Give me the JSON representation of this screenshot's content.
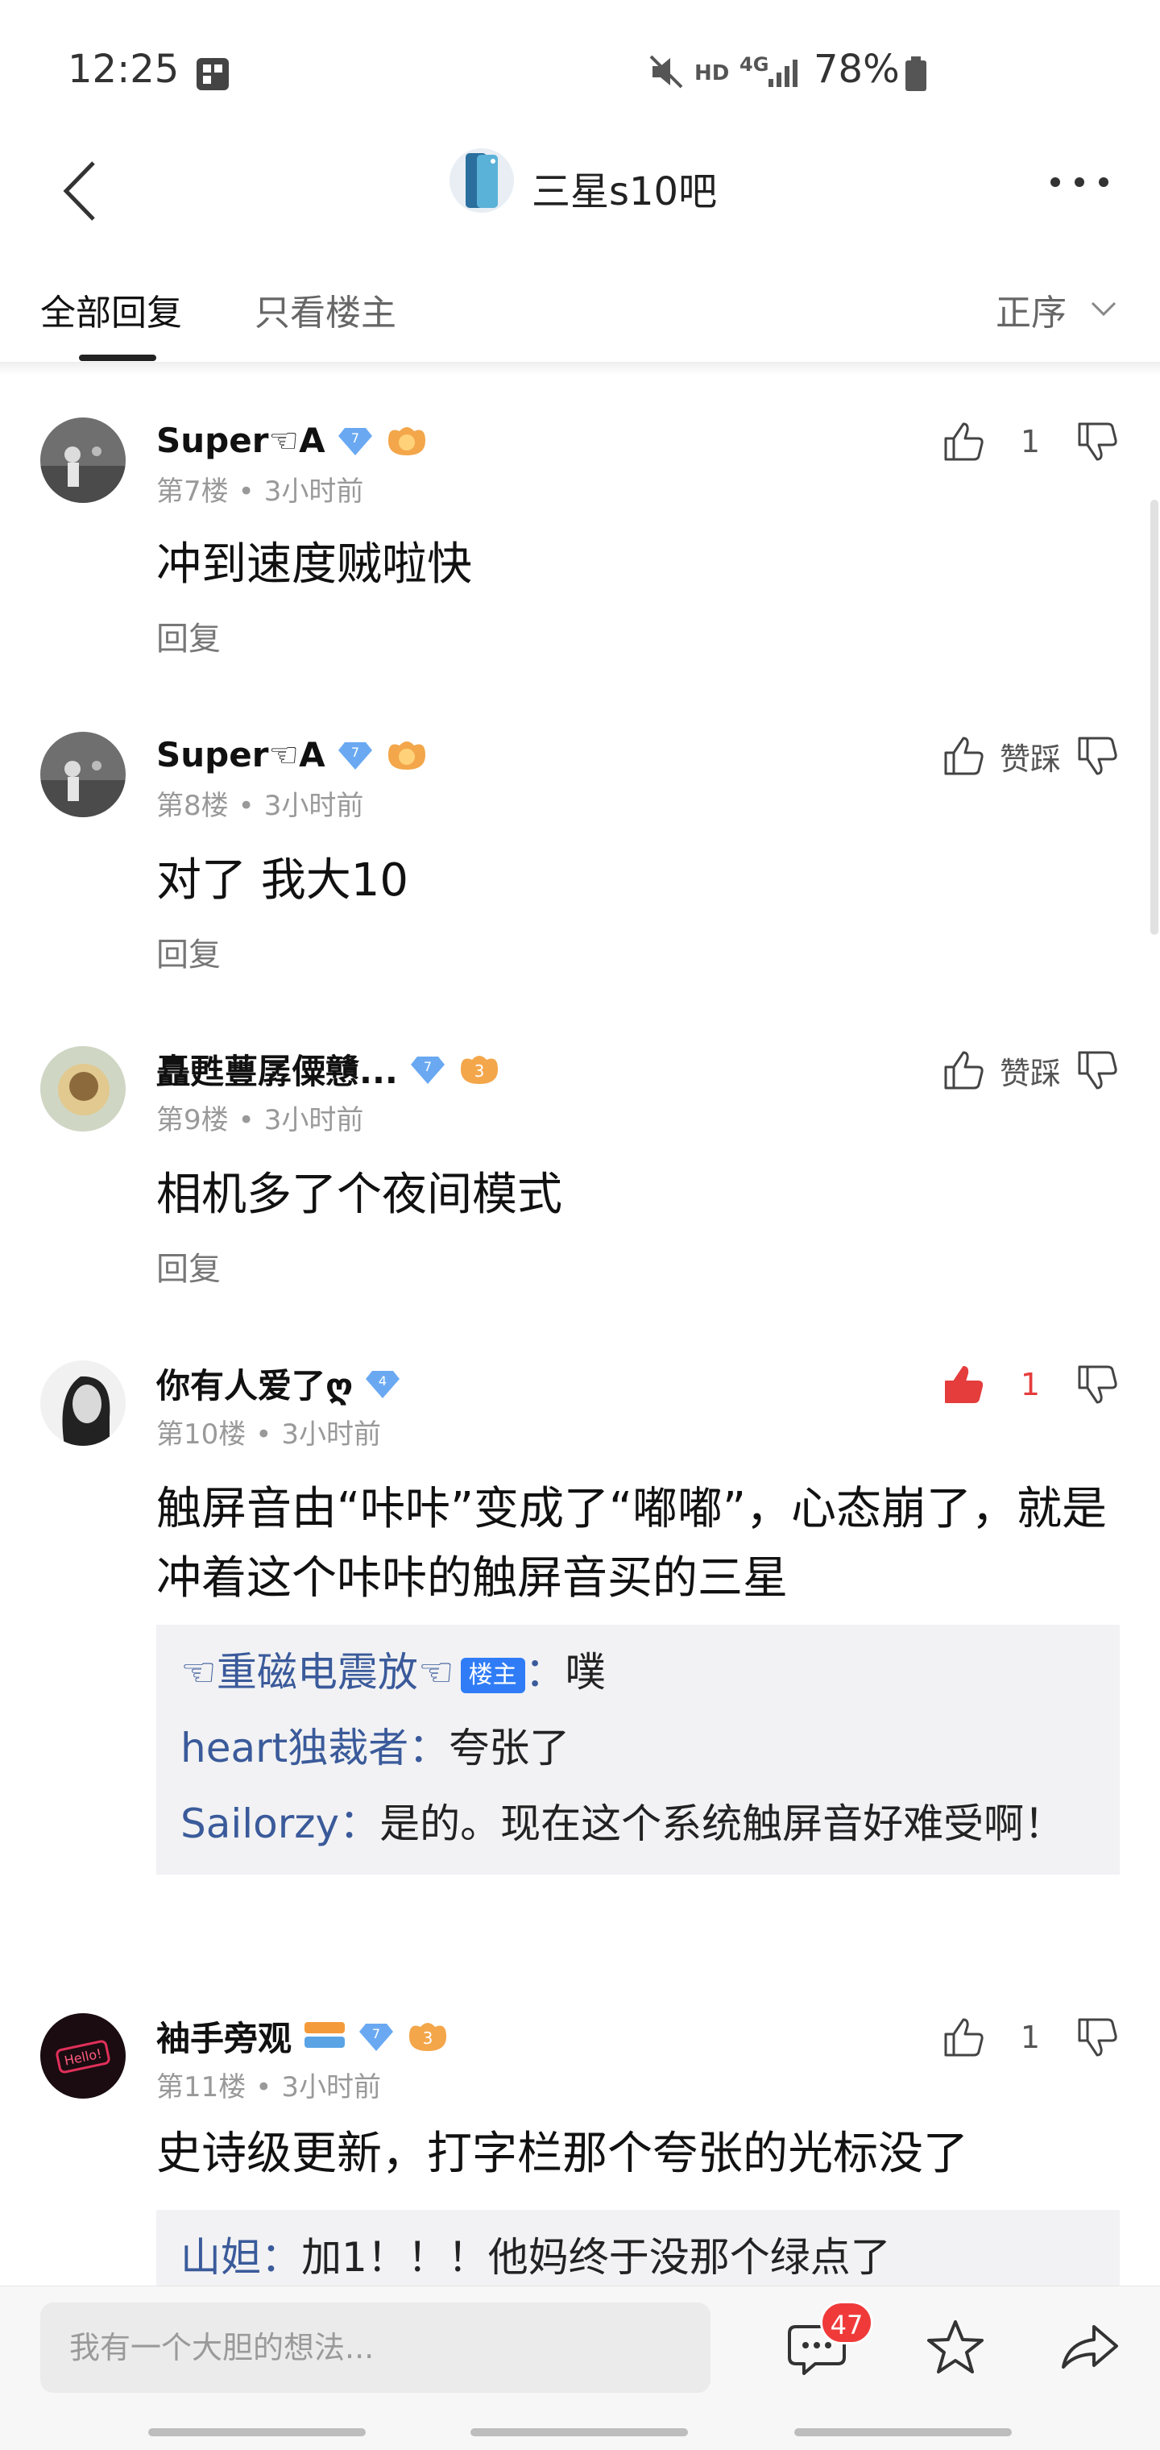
{
  "status_bar": {
    "time": "12:25",
    "network": "4G",
    "hd": "HD",
    "battery": "78%"
  },
  "header": {
    "title": "三星s10吧",
    "back_icon": "chevron-left-icon",
    "more_icon": "more-dots-icon"
  },
  "tabs": {
    "all_replies": "全部回复",
    "only_op": "只看楼主",
    "sort": "正序"
  },
  "posts": [
    {
      "username": "Super☜A",
      "floor": "第7楼",
      "time": "3小时前",
      "content": "冲到速度贼啦快",
      "reply_label": "回复",
      "likes": "1",
      "liked": false
    },
    {
      "username": "Super☜A",
      "floor": "第8楼",
      "time": "3小时前",
      "content": "对了 我大10",
      "reply_label": "回复",
      "likes_label": "赞踩",
      "liked": false
    },
    {
      "username": "矗甦蘴孱僳戇...",
      "floor": "第9楼",
      "time": "3小时前",
      "content": "相机多了个夜间模式",
      "reply_label": "回复",
      "likes_label": "赞踩",
      "liked": false
    },
    {
      "username": "你有人爱了ღ",
      "floor": "第10楼",
      "time": "3小时前",
      "content": "触屏音由“咔咔”变成了“嘟嘟”，心态崩了，就是冲着这个咔咔的触屏音买的三星",
      "likes": "1",
      "liked": true,
      "subreplies": [
        {
          "name": "☜重磁电震放☜",
          "badge": "楼主",
          "sep": "：",
          "text": "噗"
        },
        {
          "name": "heart独裁者",
          "sep": "：",
          "text": "夸张了"
        },
        {
          "name": "Sailorzy",
          "sep": "：",
          "text": "是的。现在这个系统触屏音好难受啊！"
        }
      ]
    },
    {
      "username": "袖手旁观",
      "floor": "第11楼",
      "time": "3小时前",
      "content": "史诗级更新，打字栏那个夸张的光标没了",
      "likes": "1",
      "liked": false,
      "subreplies": [
        {
          "name": "山妲",
          "sep": "：",
          "text": "加1！！！他妈终于没那个绿点了"
        }
      ]
    }
  ],
  "meta_separator": "•",
  "bottom_bar": {
    "input_placeholder": "我有一个大胆的想法...",
    "comment_count": "47"
  },
  "colors": {
    "like_red": "#e53c3c",
    "name_blue": "#3a5a9a",
    "badge_blue": "#2f7cf6"
  }
}
